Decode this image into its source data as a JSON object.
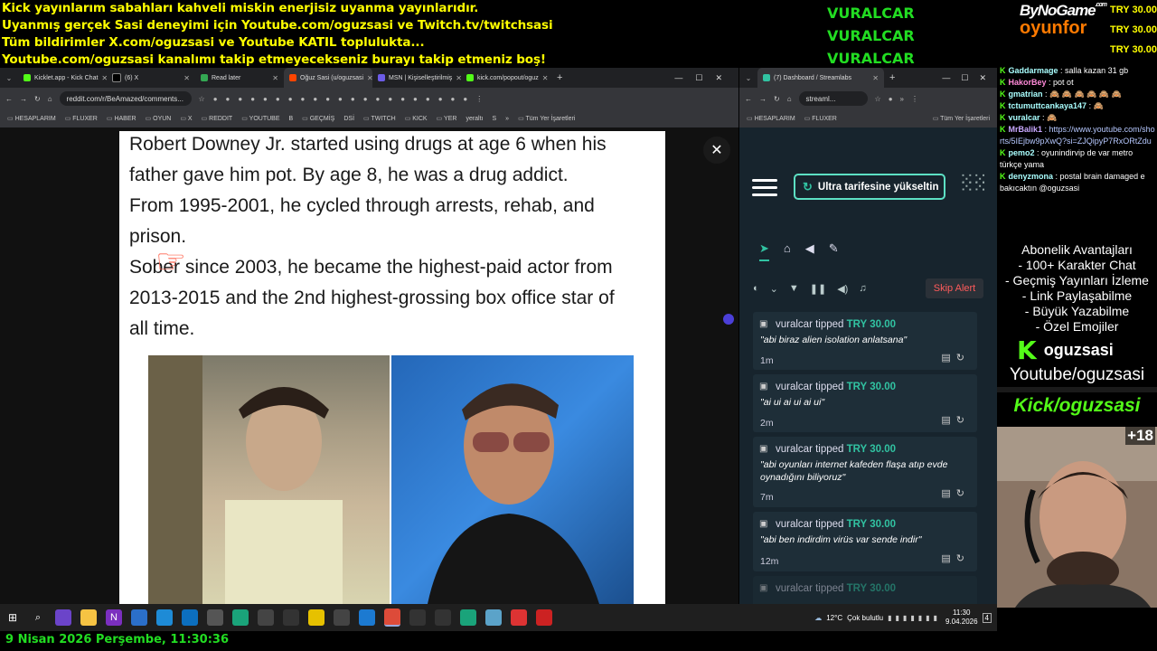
{
  "banner": {
    "line1": "Kick yayınlarım sabahları kahveli miskin enerjisiz uyanma yayınlarıdır.",
    "line2": "Uyanmış gerçek Sasi deneyimi için Youtube.com/oguzsasi ve Twitch.tv/twitchsasi",
    "line3": "Tüm bildirimler X.com/oguzsasi ve Youtube KATIL toplulukta...",
    "line4": "Youtube.com/oguzsasi kanalımı takip etmeyecekseniz burayı takip etmeniz boş!"
  },
  "recent_tippers": [
    "VURALCAR",
    "VURALCAR",
    "VURALCAR"
  ],
  "logo": {
    "top": "ByNoGame",
    "top_suffix": ".com",
    "bottom": "oyunfor"
  },
  "top_tips": [
    "TRY 30.00",
    "TRY 30.00",
    "TRY 30.00"
  ],
  "browser_left": {
    "tabs": [
      {
        "label": "Kicklet.app - Kick Chat",
        "color": "#53fc18"
      },
      {
        "label": "(6) X",
        "color": "#000000"
      },
      {
        "label": "Read later",
        "color": "#34a853"
      },
      {
        "label": "Oğuz Sasi (u/oguzsasi",
        "color": "#ff4500",
        "active": true
      },
      {
        "label": "MSN | Kişiselleştirilmiş",
        "color": "#6c5ce7"
      },
      {
        "label": "kick.com/popout/oguz",
        "color": "#53fc18"
      }
    ],
    "new_tab": "+",
    "url": "reddit.com/r/BeAmazed/comments...",
    "bookmarks": [
      "HESAPLARIM",
      "FLUXER",
      "HABER",
      "OYUN",
      "X",
      "REDDIT",
      "YOUTUBE",
      "B",
      "GEÇMİŞ",
      "DSİ",
      "TWITCH",
      "KICK",
      "YER",
      "yeraltı",
      "S"
    ],
    "bookmarks_more": "»",
    "all_bookmarks": "Tüm Yer İşaretleri",
    "post_lines": [
      "Robert Downey Jr. started using drugs at age 6 when his",
      "father gave him pot. By age 8, he was a drug addict.",
      "From 1995-2001, he cycled through arrests, rehab, and",
      "prison.",
      "Sober since 2003, he became the highest-paid actor from",
      "2013-2015 and the 2nd highest-grossing box office star of",
      "all time."
    ],
    "close": "✕"
  },
  "browser_right": {
    "tab_label": "(7) Dashboard / Streamlabs",
    "url": "streaml...",
    "bookmarks": [
      "HESAPLARIM",
      "FLUXER"
    ],
    "all_bookmarks": "Tüm Yer İşaretleri",
    "upgrade_label": "Ultra tarifesine yükseltin",
    "skip_alert": "Skip Alert",
    "tips": [
      {
        "user": "vuralcar",
        "verb": "tipped",
        "amount": "TRY 30.00",
        "message": "\"abi biraz alien isolation anlatsana\"",
        "time": "1m"
      },
      {
        "user": "vuralcar",
        "verb": "tipped",
        "amount": "TRY 30.00",
        "message": "\"ai ui ai ui ai ui\"",
        "time": "2m"
      },
      {
        "user": "vuralcar",
        "verb": "tipped",
        "amount": "TRY 30.00",
        "message": "\"abi oyunları internet kafeden flaşa atıp evde oynadığını biliyoruz\"",
        "time": "7m"
      },
      {
        "user": "vuralcar",
        "verb": "tipped",
        "amount": "TRY 30.00",
        "message": "\"abi ben indirdim virüs var sende indir\"",
        "time": "12m"
      },
      {
        "user": "vuralcar",
        "verb": "tipped",
        "amount": "TRY 30.00",
        "message": "",
        "time": ""
      }
    ]
  },
  "chat": [
    {
      "user": "Gaddarmage",
      "text": ": salla kazan 31 gb"
    },
    {
      "user": "HakorBey",
      "text": ": pot ot"
    },
    {
      "user": "gmatrian",
      "text": ": 🙈 🙈 🙈 🙈 🙈 🙈"
    },
    {
      "user": "tctumuttcankaya147",
      "text": ": 🙈"
    },
    {
      "user": "vuralcar",
      "text": ": 🙈"
    },
    {
      "user": "MrBalik1",
      "text": ": https://www.youtube.com/shorts/5IEjbw9pXwQ?si=ZJQipyP7RxORtZdu"
    },
    {
      "user": "pemo2",
      "text": ": oyunindirvip de var metro türkçe yama"
    },
    {
      "user": "denyzmona",
      "text": ": postal brain damaged e bakıcaktın @oguzsasi"
    }
  ],
  "perks": {
    "title": "Abonelik Avantajları",
    "items": [
      "- 100+ Karakter Chat",
      "- Geçmiş Yayınları İzleme",
      "- Link Paylaşabilme",
      "- Büyük Yazabilme",
      "- Özel Emojiler"
    ]
  },
  "socials": {
    "kick_handle": "oguzsasi",
    "youtube": "Youtube/oguzsasi",
    "kick": "Kick/oguzsasi"
  },
  "cam_badge": "+18",
  "taskbar": {
    "weather_temp": "12°C",
    "weather_text": "Çok bulutlu",
    "time": "11:30",
    "date": "9.04.2026",
    "notif_count": "4"
  },
  "date_line": "9 Nisan 2026 Perşembe, 11:30:36"
}
